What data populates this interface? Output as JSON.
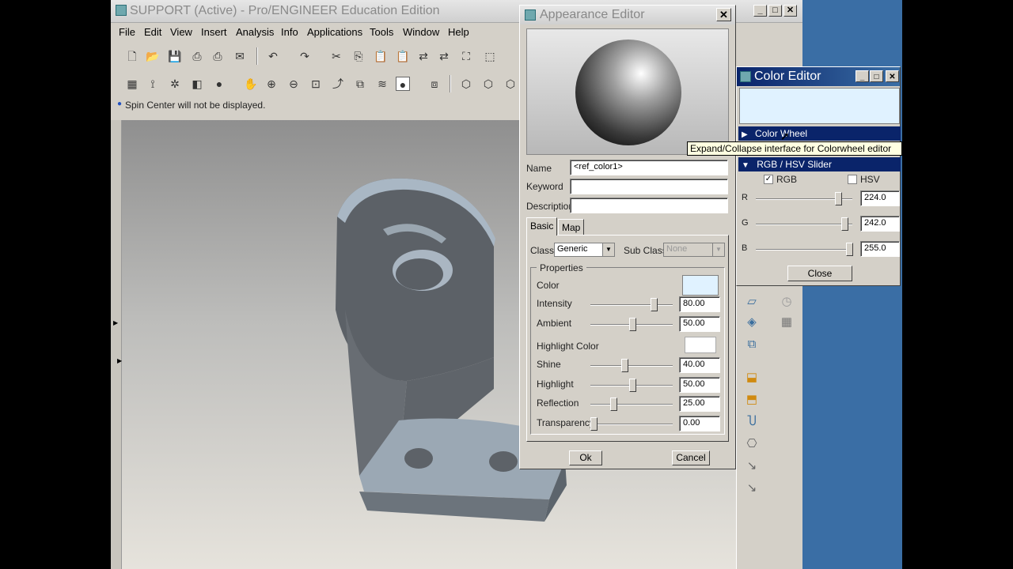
{
  "main": {
    "title": "SUPPORT (Active) - Pro/ENGINEER Education Edition",
    "menus": [
      "File",
      "Edit",
      "View",
      "Insert",
      "Analysis",
      "Info",
      "Applications",
      "Tools",
      "Window",
      "Help"
    ],
    "message": "Spin Center will not be displayed."
  },
  "appearance": {
    "title": "Appearance Editor",
    "name_label": "Name",
    "name_value": "<ref_color1>",
    "keyword_label": "Keyword",
    "keyword_value": "",
    "description_label": "Description",
    "description_value": "",
    "tabs": [
      "Basic",
      "Map"
    ],
    "class_label": "Class",
    "class_value": "Generic",
    "subclass_label": "Sub Class",
    "subclass_value": "None",
    "properties_label": "Properties",
    "color_label": "Color",
    "highlight_color_label": "Highlight Color",
    "sliders": [
      {
        "label": "Intensity",
        "value": "80.00",
        "fraction": 0.78
      },
      {
        "label": "Ambient",
        "value": "50.00",
        "fraction": 0.5
      },
      {
        "label": "Shine",
        "value": "40.00",
        "fraction": 0.4
      },
      {
        "label": "Highlight",
        "value": "50.00",
        "fraction": 0.5
      },
      {
        "label": "Reflection",
        "value": "25.00",
        "fraction": 0.25
      },
      {
        "label": "Transparency",
        "value": "0.00",
        "fraction": 0.0
      }
    ],
    "ok_label": "Ok",
    "cancel_label": "Cancel",
    "color_swatch": "#e0f2ff",
    "highlight_swatch": "#ffffff"
  },
  "color_editor": {
    "title": "Color Editor",
    "preview_color": "#e0f2ff",
    "color_wheel_label": "Color Wheel",
    "rgb_hsv_label": "RGB / HSV Slider",
    "rgb_label": "RGB",
    "hsv_label": "HSV",
    "rgb_checked": "✓",
    "channels": [
      {
        "label": "R",
        "value": "224.0",
        "fraction": 0.878
      },
      {
        "label": "G",
        "value": "242.0",
        "fraction": 0.949
      },
      {
        "label": "B",
        "value": "255.0",
        "fraction": 1.0
      }
    ],
    "close_label": "Close",
    "tooltip": "Expand/Collapse interface for Colorwheel editor"
  }
}
